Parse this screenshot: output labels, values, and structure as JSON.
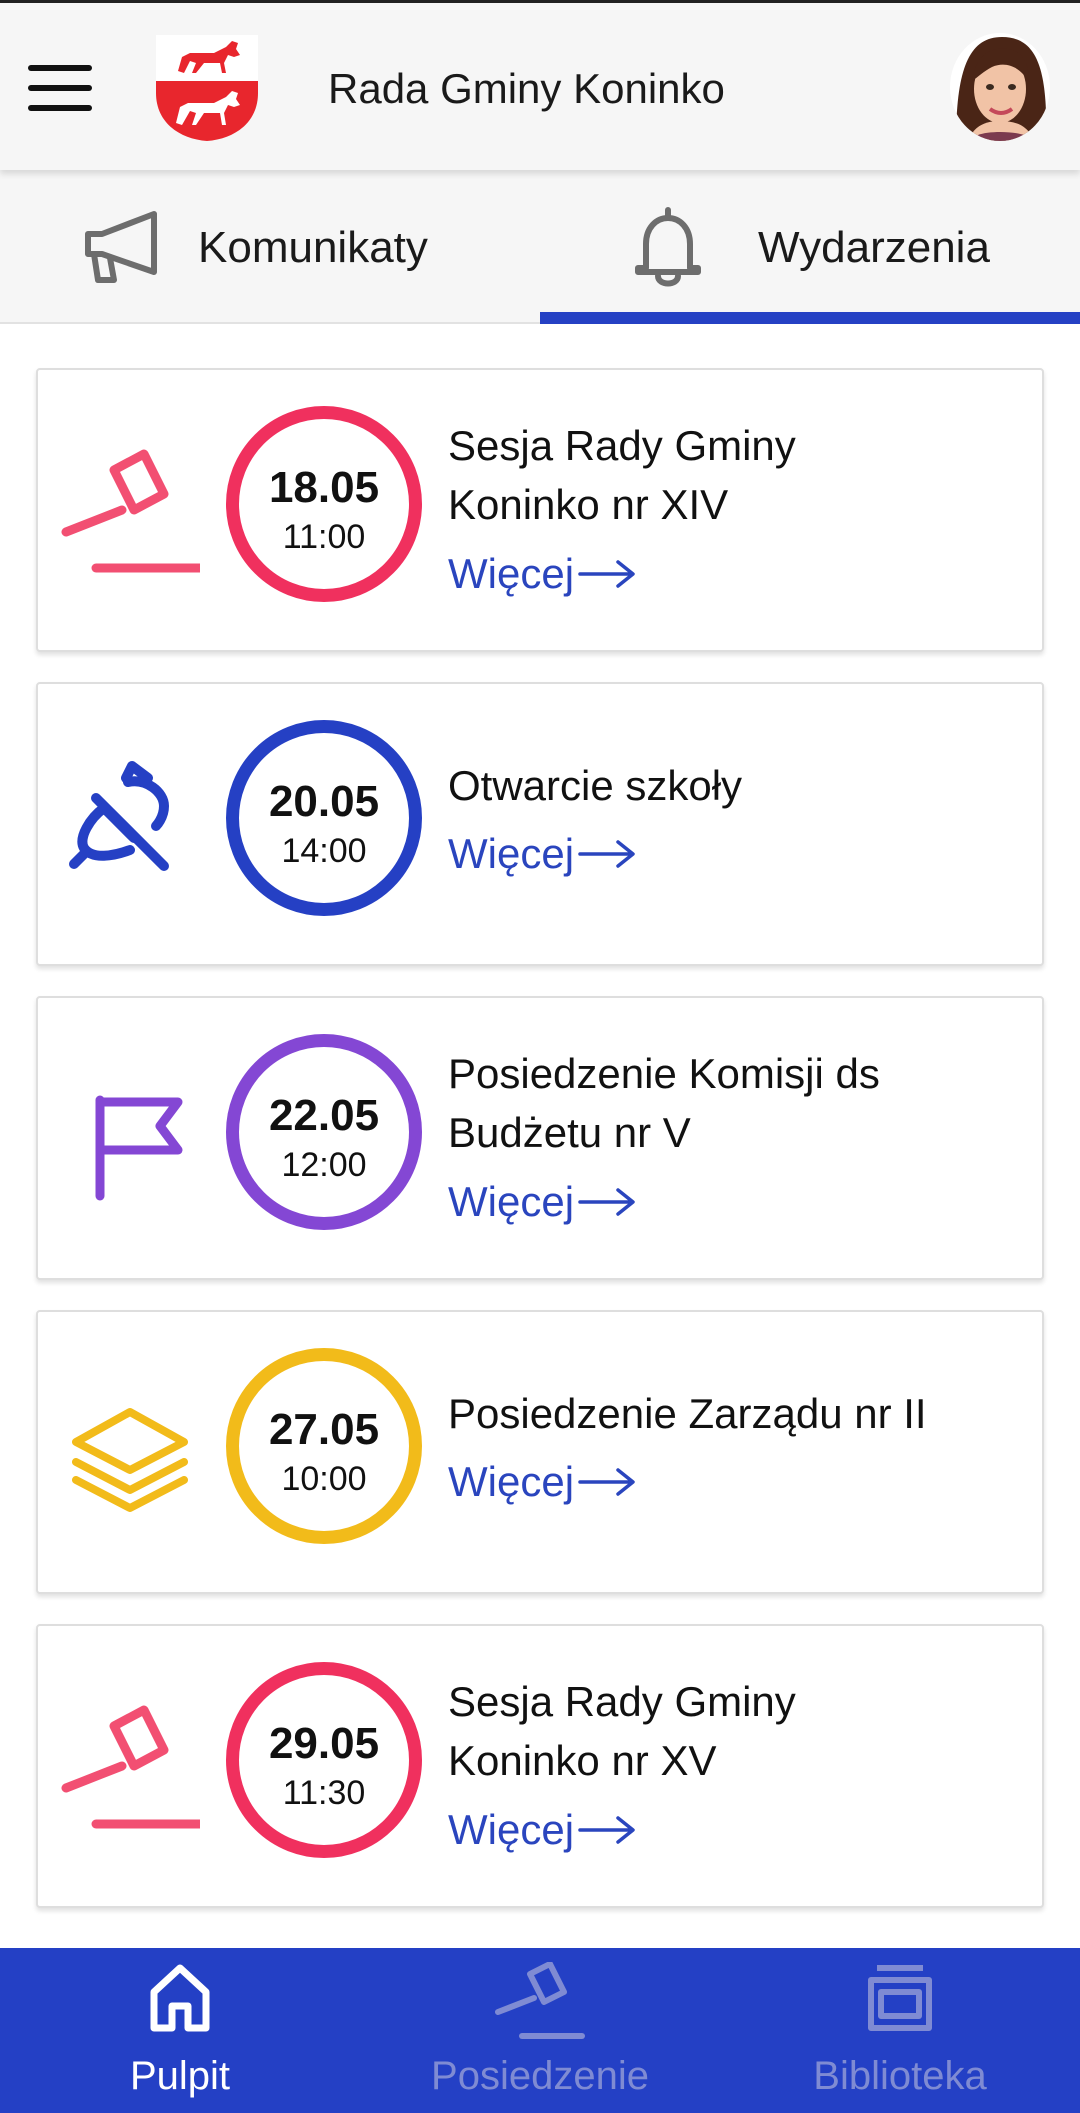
{
  "header": {
    "title": "Rada Gminy Koninko",
    "menu_icon": "hamburger-menu-icon",
    "logo": "coat-of-arms-horses",
    "avatar": "user-avatar-photo"
  },
  "tabs": [
    {
      "label": "Komunikaty",
      "icon": "megaphone-icon",
      "active": false
    },
    {
      "label": "Wydarzenia",
      "icon": "bell-icon",
      "active": true
    }
  ],
  "colors": {
    "accent": "#2541c4",
    "red": "#f0305e",
    "blue": "#2540c4",
    "purple": "#8447d4",
    "yellow": "#f2bb1a",
    "link": "#2a45be"
  },
  "events": [
    {
      "day": "18.05",
      "time": "11:00",
      "title_lines": [
        "Sesja Rady Gminy",
        "Koninko nr XIV"
      ],
      "more": "Więcej",
      "icon": "gavel-icon",
      "color": "#f0305e"
    },
    {
      "day": "20.05",
      "time": "14:00",
      "title_lines": [
        "Otwarcie szkoły"
      ],
      "more": "Więcej",
      "icon": "bell-off-icon",
      "color": "#2540c4"
    },
    {
      "day": "22.05",
      "time": "12:00",
      "title_lines": [
        "Posiedzenie Komisji ds",
        "Budżetu nr V"
      ],
      "more": "Więcej",
      "icon": "flag-icon",
      "color": "#8447d4"
    },
    {
      "day": "27.05",
      "time": "10:00",
      "title_lines": [
        "Posiedzenie Zarządu nr II"
      ],
      "more": "Więcej",
      "icon": "layers-icon",
      "color": "#f2bb1a"
    },
    {
      "day": "29.05",
      "time": "11:30",
      "title_lines": [
        "Sesja Rady Gminy",
        "Koninko nr XV"
      ],
      "more": "Więcej",
      "icon": "gavel-icon",
      "color": "#f0305e"
    }
  ],
  "bottom_nav": [
    {
      "label": "Pulpit",
      "icon": "home-icon",
      "active": true
    },
    {
      "label": "Posiedzenie",
      "icon": "gavel-icon",
      "active": false
    },
    {
      "label": "Biblioteka",
      "icon": "archive-box-icon",
      "active": false
    }
  ]
}
